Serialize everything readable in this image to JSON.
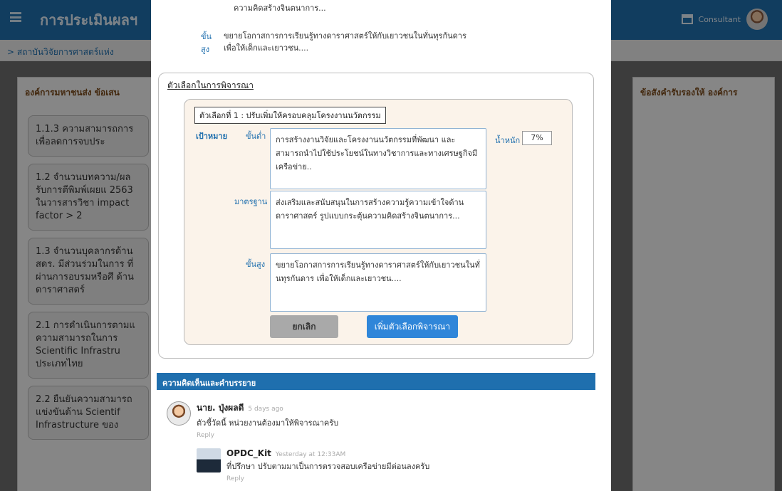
{
  "app": {
    "title": "การประเมินผลฯ",
    "user": "Consultant",
    "breadcrumb": "> สถาบันวิจัยการศาสตร์แห่ง"
  },
  "background": {
    "left_header": "องค์การมหาชนส่ง ข้อเสน",
    "left_cards": [
      "1.1.3 ความสามารถการ เพื่อลดการจบประ",
      "1.2 จำนวนบทความ/ผล รับการตีพิมพ์เผยแ 2563 ในวารสารวิชา impact factor > 2",
      "1.3 จำนวนบุคลากรด้าน สดร. มีส่วนร่วมในการ ที่ผ่านการอบรมหรือศึ ด้านดาราศาสตร์",
      "2.1 การดำเนินการตามแ ความสามารถในการ Scientific Infrastru ประเภทไทย",
      "2.2 ยืนยันความสามารถ แข่งขันด้าน Scientif Infrastructure ของ"
    ],
    "right_header": "ข้อสังคำรับรองให้ องค์การ"
  },
  "modal": {
    "top_text": "ความคิดสร้างจินตนาการ...",
    "top_goal_label": "ขั้นสูง",
    "top_goal_text_1": "ขยายโอกาสการการเรียนรู้ทางดาราศาสตร์ให้กับเยาวชนในทั่นทุรกันดาร",
    "top_goal_text_2": "เพื่อให้เด็กและเยาวชน....",
    "consider_title": "ตัวเลือกในการพิจารณา",
    "option_tag": "ตัวเลือกที่ 1 : ปรับเพิ่มให้ครอบคลุมโครงงานนวัตกรรม",
    "target_label": "เป้าหมาย",
    "min_label": "ขั้นต่ำ",
    "min_text": "การสร้างงานวิจัยและโครงงานนวัตกรรมที่พัฒนา และสามารถนำไปใช้ประโยชน์ในทางวิชาการและทางเศรษฐกิจมีเครือข่าย..",
    "weight_label": "น้ำหนัก",
    "weight_value": "7%",
    "std_label": "มาตรฐาน",
    "std_text": "ส่งเสริมและสนับสนุนในการสร้างความรู้ความเข้าใจด้านดาราศาสตร์ รูปแบบกระตุ้นความคิดสร้างจินตนาการ...",
    "high_label": "ขั้นสูง",
    "high_text": "ขยายโอกาสการการเรียนรู้ทางดาราศาสตร์ให้กับเยาวชนในทั่นทุรกันดาร เพื่อให้เด็กและเยาวชน....",
    "cancel_button": "ยกเลิก",
    "add_button": "เพิ่มตัวเลือกพิจารณา",
    "comments_title": "ความคิดเห็นและคำบรรยาย",
    "comments": [
      {
        "name": "นาย. ปุ่งผลดี",
        "time": "5 days ago",
        "text": "ตัวชี้วัดนี้ หน่วยงานต้องมาให้พิจารณาครับ",
        "reply": "Reply"
      },
      {
        "name": "OPDC_Kit",
        "time": "Yesterday at 12:33AM",
        "text": "ที่ปรึกษา ปรับตามมาเป็นการตรวจสอบเครือข่ายมีต่อนลงครับ",
        "reply": "Reply"
      }
    ]
  }
}
